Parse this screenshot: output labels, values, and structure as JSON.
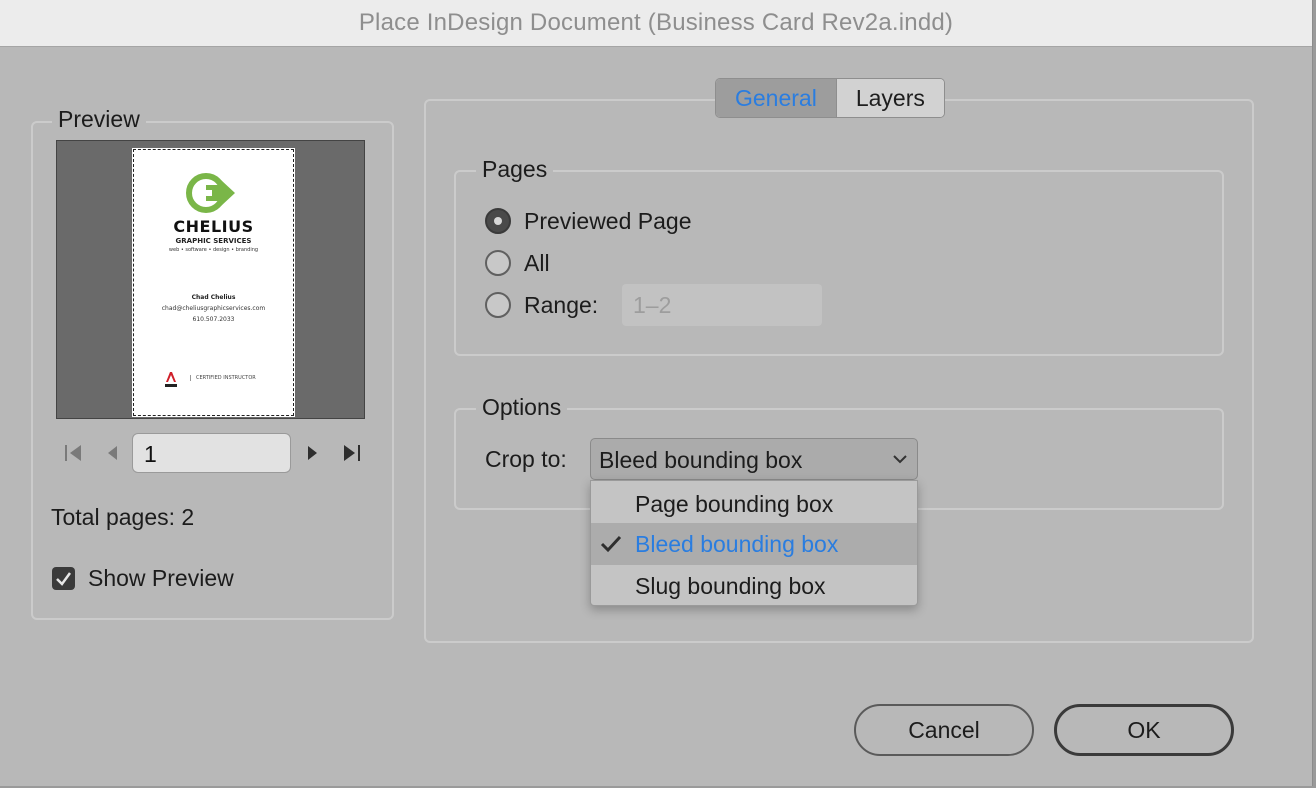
{
  "window": {
    "title": "Place InDesign Document (Business Card Rev2a.indd)"
  },
  "preview": {
    "legend": "Preview",
    "card": {
      "company": "CHELIUS",
      "subtitle": "GRAPHIC SERVICES",
      "tagline": "web • software • design • branding",
      "person": "Chad Chelius",
      "email": "chad@cheliusgraphicservices.com",
      "phone": "610.507.2033",
      "certification": "CERTIFIED INSTRUCTOR",
      "logo_color": "#7ab648"
    },
    "page_field": "1",
    "total_pages": "Total pages: 2",
    "show_preview_label": "Show Preview",
    "show_preview_checked": true
  },
  "tabs": [
    {
      "label": "General",
      "active": true
    },
    {
      "label": "Layers",
      "active": false
    }
  ],
  "pages": {
    "legend": "Pages",
    "options": [
      {
        "label": "Previewed Page",
        "selected": true
      },
      {
        "label": "All",
        "selected": false
      },
      {
        "label": "Range:",
        "selected": false
      }
    ],
    "range_value": "1–2"
  },
  "options": {
    "legend": "Options",
    "crop_label": "Crop to:",
    "crop_value": "Bleed bounding box",
    "dropdown_items": [
      {
        "label": "Page bounding box",
        "checked": false
      },
      {
        "label": "Bleed bounding box",
        "checked": true
      },
      {
        "label": "Slug bounding box",
        "checked": false
      }
    ]
  },
  "buttons": {
    "cancel": "Cancel",
    "ok": "OK"
  },
  "colors": {
    "accent": "#2a7de0",
    "dialog_bg": "#b8b8b8"
  }
}
